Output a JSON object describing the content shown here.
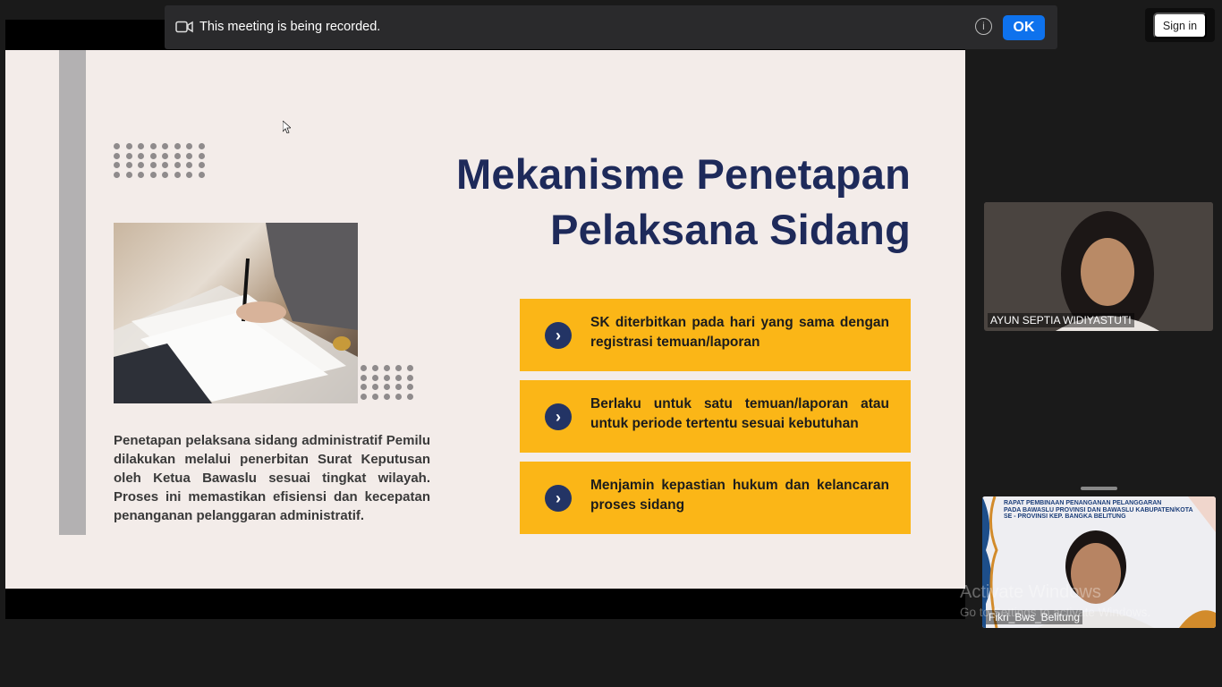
{
  "banner": {
    "message": "This meeting is being recorded.",
    "ok_label": "OK",
    "camera_icon": "video-camera-icon",
    "info_icon": "info-icon"
  },
  "signin": {
    "label": "Sign in"
  },
  "slide": {
    "title_line1": "Mekanisme Penetapan",
    "title_line2": "Pelaksana Sidang",
    "description": "Penetapan pelaksana sidang administratif Pemilu dilakukan melalui penerbitan Surat Keputusan oleh Ketua Bawaslu sesuai tingkat wilayah. Proses ini memastikan efisiensi dan kecepatan penanganan pelanggaran administratif.",
    "cards": [
      {
        "text": "SK diterbitkan pada hari yang sama dengan registrasi temuan/laporan"
      },
      {
        "text": "Berlaku untuk satu temuan/laporan atau untuk periode tertentu sesuai kebutuhan"
      },
      {
        "text": "Menjamin kepastian hukum dan kelancaran proses sidang"
      }
    ],
    "accent_color": "#fbb617",
    "title_color": "#1e2a5a"
  },
  "participants": [
    {
      "name": "AYUN SEPTIA WIDIYASTUTI"
    },
    {
      "name": "Fikri_Bws_Belitung"
    }
  ],
  "background_text": {
    "line1": "RAPAT PEMBINAAN PENANGANAN PELANGGARAN",
    "line2": "PADA BAWASLU PROVINSI DAN BAWASLU KABUPATEN/KOTA",
    "line3": "SE - PROVINSI KEP. BANGKA BELITUNG"
  },
  "watermark": {
    "line1": "Activate Windows",
    "line2": "Go to Settings to activate Windows."
  }
}
